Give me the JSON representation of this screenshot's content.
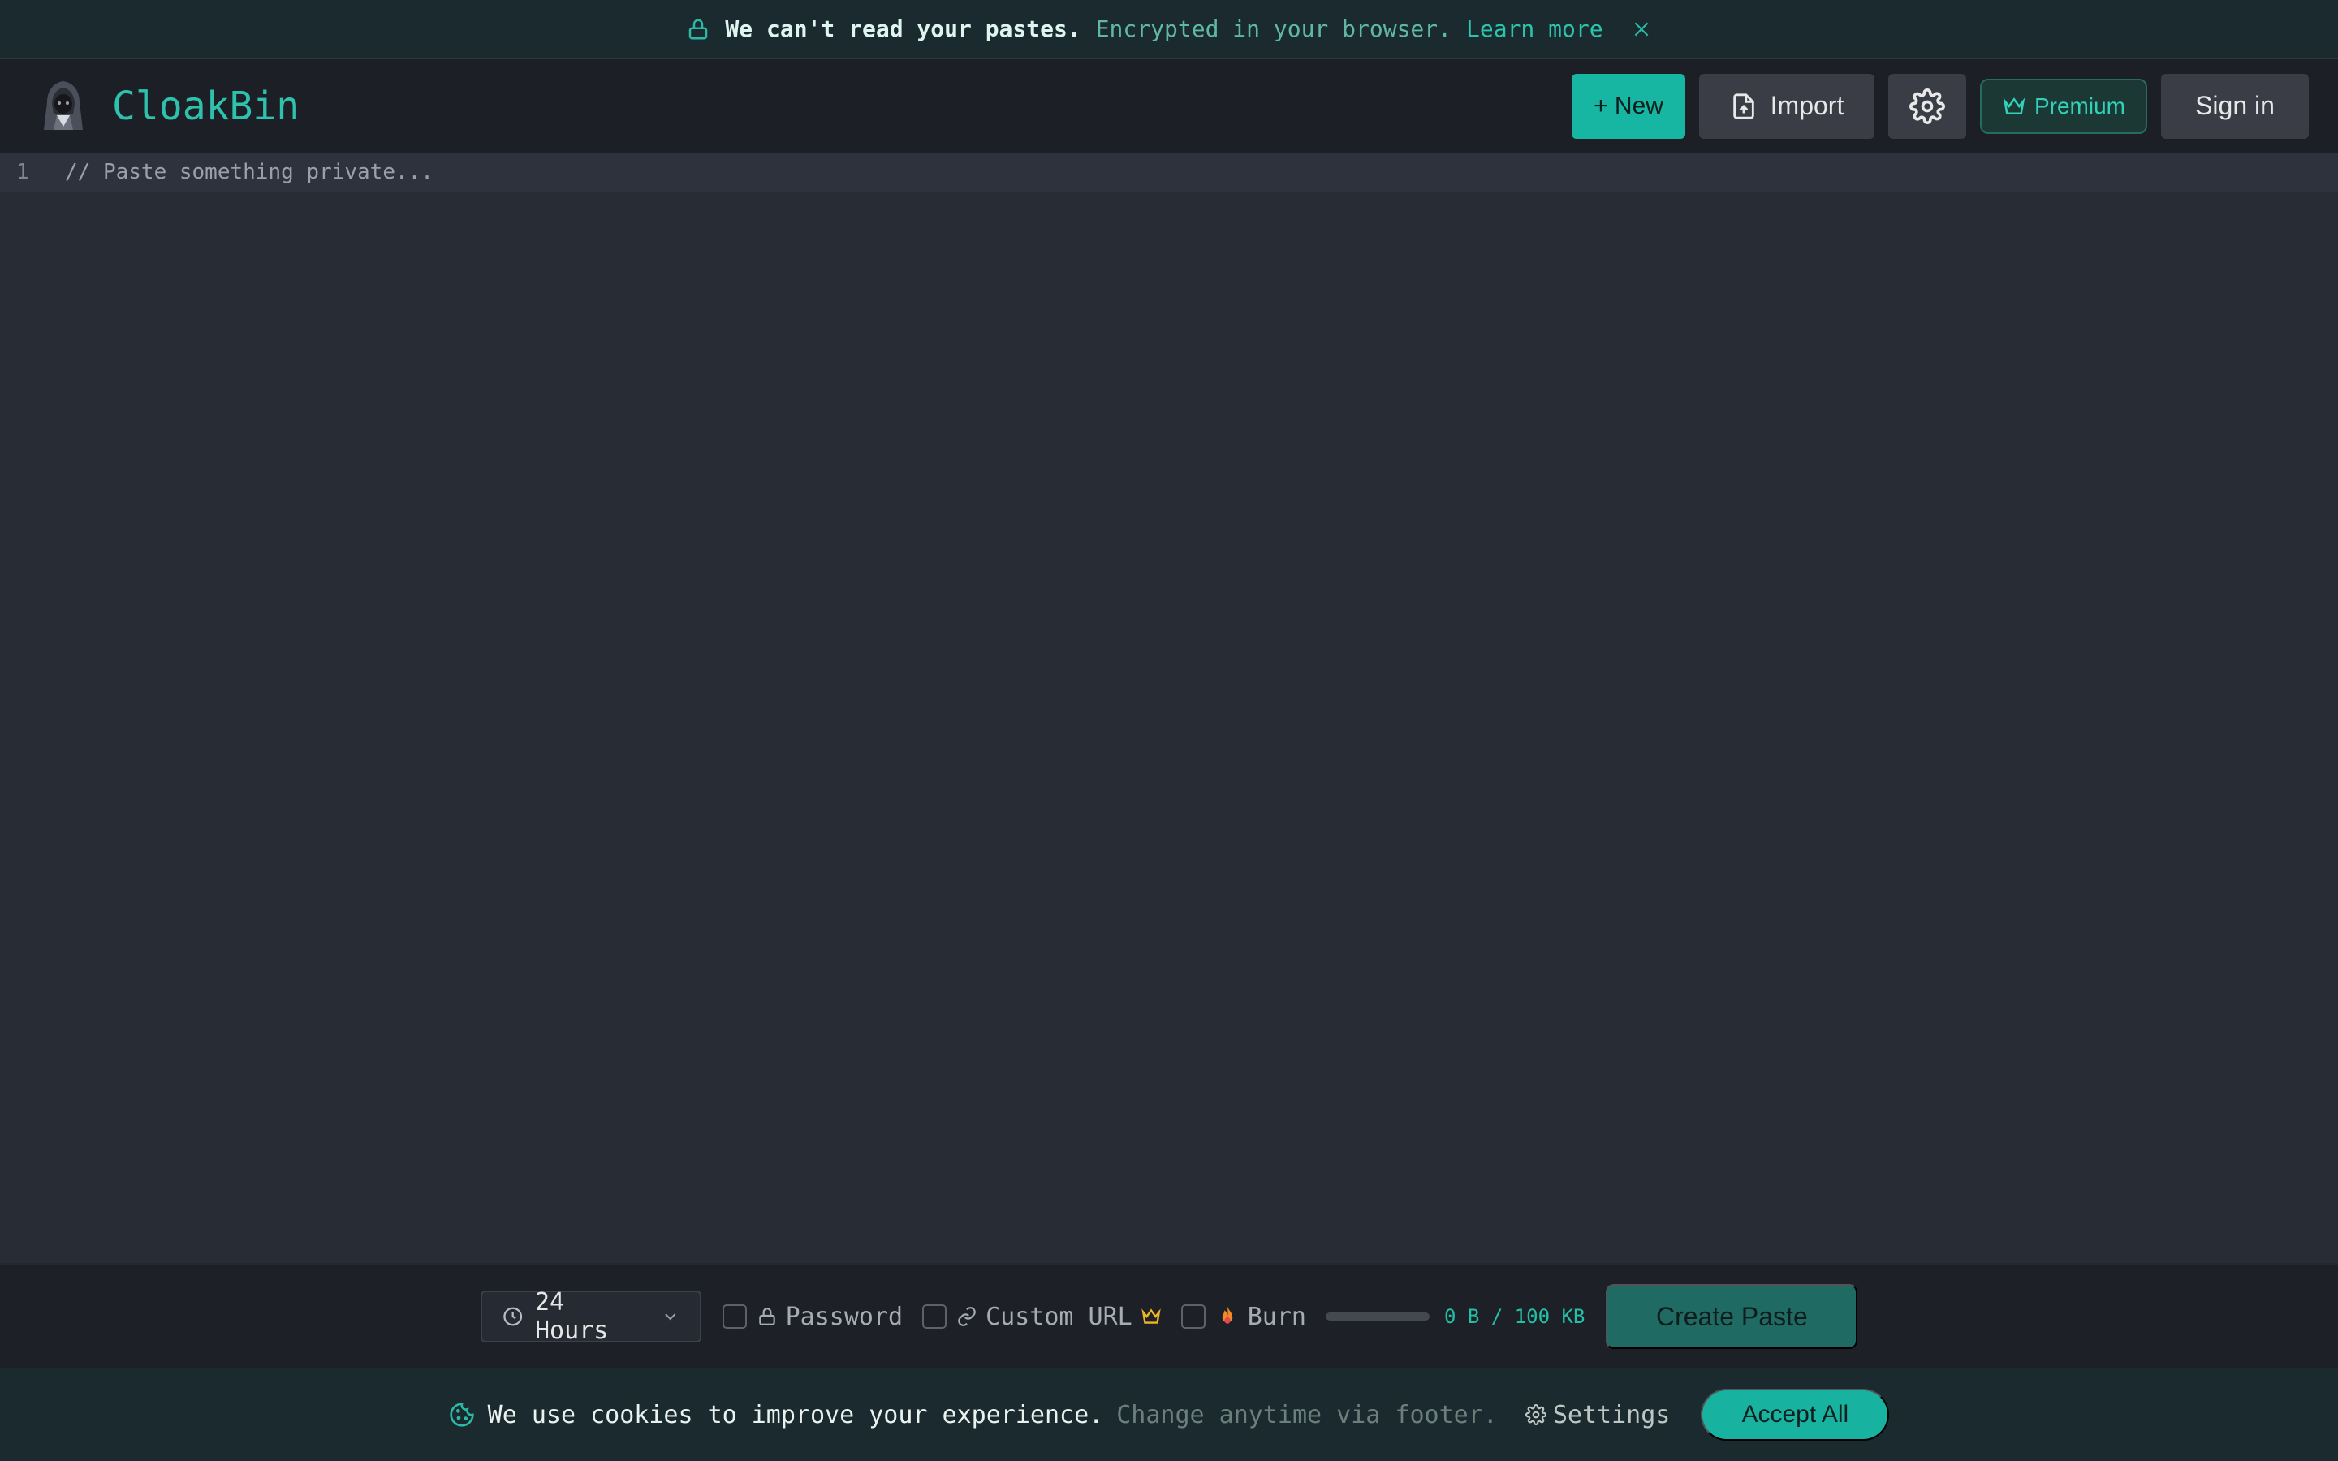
{
  "banner": {
    "strong_text": "We can't read your pastes.",
    "muted_text": "Encrypted in your browser.",
    "link_text": "Learn more",
    "icons": {
      "lock": "lock-icon",
      "close": "close-icon"
    }
  },
  "header": {
    "brand": "CloakBin",
    "new_label": "+ New",
    "import_label": "Import",
    "premium_label": "Premium",
    "signin_label": "Sign in"
  },
  "editor": {
    "line_number": "1",
    "placeholder": "// Paste something private..."
  },
  "toolbar": {
    "expiry_value": "24 Hours",
    "password_label": "Password",
    "custom_url_label": "Custom URL",
    "burn_label": "Burn",
    "size_text": "0 B / 100 KB",
    "create_label": "Create Paste"
  },
  "cookie": {
    "main_text": "We use cookies to improve your experience.",
    "muted_text": "Change anytime via footer.",
    "settings_label": "Settings",
    "accept_label": "Accept All"
  },
  "colors": {
    "accent": "#16b6a3",
    "background": "#282c35",
    "header_bg": "#1c1f26",
    "banner_bg": "#1a2a2e"
  }
}
